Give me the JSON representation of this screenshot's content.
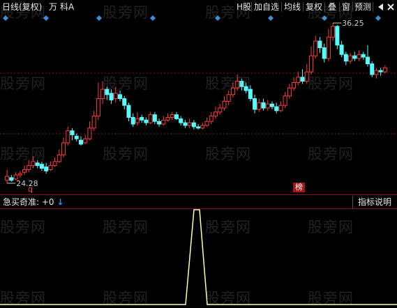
{
  "toolbar": {
    "period": "日线(复权)",
    "unit": "万",
    "tech": "科",
    "tech_suffix": "A",
    "h_share": "H股",
    "add_watch": "加自选",
    "ma": "均线",
    "fuquan": "复权",
    "overlay": "叠",
    "window": "窗",
    "forecast": "预测"
  },
  "price_chart": {
    "high_label": "36.25",
    "low_label": "24.28",
    "q_marker": "q",
    "bang_badge": "榜",
    "up_color": "#ff3c3c",
    "down_color": "#54fcfc",
    "grid_color": "#8a1010",
    "marker_color": "#3a8fd8"
  },
  "indicator": {
    "name": "急买奇准:",
    "value": "+0",
    "arrow": "↓",
    "help": "指标说明",
    "line_color": "#ffffb0"
  },
  "watermark": "股旁网"
}
